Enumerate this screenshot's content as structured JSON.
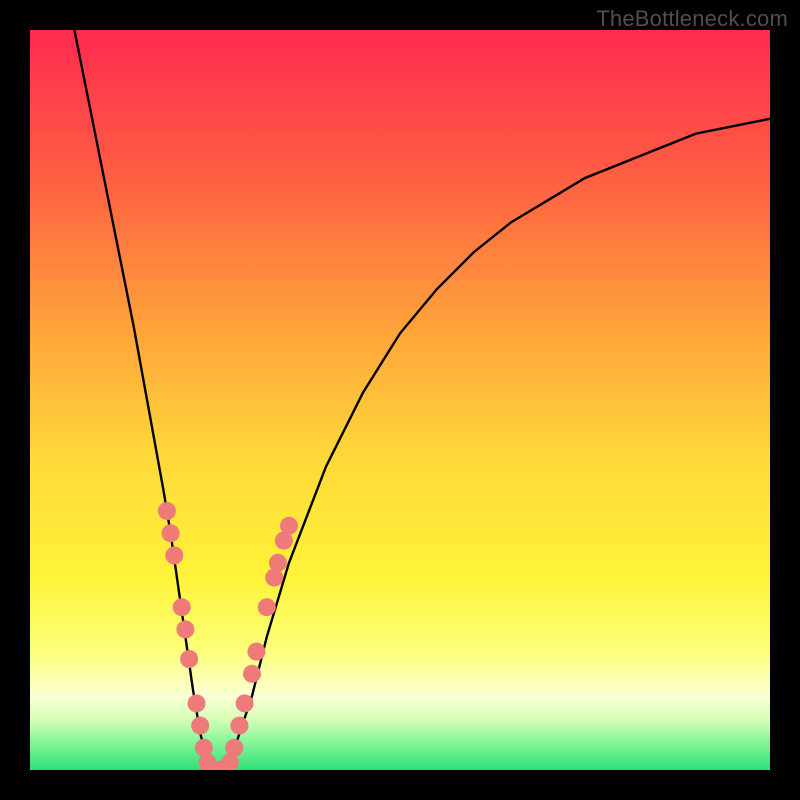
{
  "watermark": "TheBottleneck.com",
  "colors": {
    "frame": "#000000",
    "curve": "#000000",
    "markers": "#ee7a79",
    "green_band": "#2fe07a"
  },
  "chart_data": {
    "type": "line",
    "title": "",
    "xlabel": "",
    "ylabel": "",
    "xlim": [
      0,
      100
    ],
    "ylim": [
      0,
      100
    ],
    "gradient_stops": [
      {
        "offset": 0.0,
        "color": "#ff2b4e"
      },
      {
        "offset": 0.18,
        "color": "#ff5944"
      },
      {
        "offset": 0.4,
        "color": "#ffa23a"
      },
      {
        "offset": 0.58,
        "color": "#ffd93a"
      },
      {
        "offset": 0.74,
        "color": "#fff33a"
      },
      {
        "offset": 0.84,
        "color": "#fcff7a"
      },
      {
        "offset": 0.9,
        "color": "#fbffd6"
      },
      {
        "offset": 0.93,
        "color": "#d9ffb8"
      },
      {
        "offset": 0.96,
        "color": "#8cf79a"
      },
      {
        "offset": 1.0,
        "color": "#2fe07a"
      }
    ],
    "series": [
      {
        "name": "bottleneck-curve",
        "x": [
          6,
          8,
          10,
          12,
          14,
          16,
          18,
          19,
          20,
          21,
          22,
          23,
          24,
          25,
          26,
          27,
          28,
          30,
          32,
          35,
          40,
          45,
          50,
          55,
          60,
          65,
          70,
          75,
          80,
          85,
          90,
          95,
          100
        ],
        "values": [
          100,
          90,
          80,
          70,
          60,
          49,
          38,
          32,
          25,
          18,
          11,
          5,
          1,
          0,
          0,
          1,
          4,
          10,
          18,
          28,
          41,
          51,
          59,
          65,
          70,
          74,
          77,
          80,
          82,
          84,
          86,
          87,
          88
        ]
      }
    ],
    "markers": {
      "name": "highlight-dots",
      "points": [
        {
          "x": 18.5,
          "y": 35
        },
        {
          "x": 19.0,
          "y": 32
        },
        {
          "x": 19.5,
          "y": 29
        },
        {
          "x": 20.5,
          "y": 22
        },
        {
          "x": 21.0,
          "y": 19
        },
        {
          "x": 21.5,
          "y": 15
        },
        {
          "x": 22.5,
          "y": 9
        },
        {
          "x": 23.0,
          "y": 6
        },
        {
          "x": 23.5,
          "y": 3
        },
        {
          "x": 24.0,
          "y": 1
        },
        {
          "x": 24.7,
          "y": 0
        },
        {
          "x": 25.5,
          "y": 0
        },
        {
          "x": 26.3,
          "y": 0
        },
        {
          "x": 27.0,
          "y": 1
        },
        {
          "x": 27.6,
          "y": 3
        },
        {
          "x": 28.3,
          "y": 6
        },
        {
          "x": 29.0,
          "y": 9
        },
        {
          "x": 30.0,
          "y": 13
        },
        {
          "x": 30.6,
          "y": 16
        },
        {
          "x": 32.0,
          "y": 22
        },
        {
          "x": 33.0,
          "y": 26
        },
        {
          "x": 33.5,
          "y": 28
        },
        {
          "x": 34.3,
          "y": 31
        },
        {
          "x": 35.0,
          "y": 33
        }
      ]
    }
  }
}
